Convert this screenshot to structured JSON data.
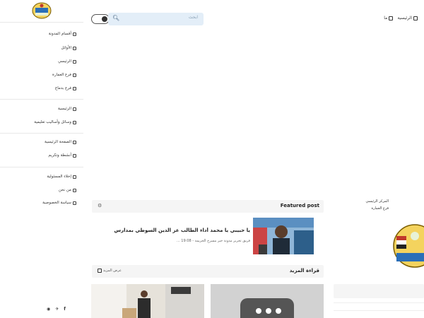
{
  "topbar": {
    "search_placeholder": "ابحث",
    "links": [
      {
        "label": "ما",
        "icon": "bookmark-icon"
      },
      {
        "label": "الرئيسية",
        "icon": "home-icon"
      }
    ]
  },
  "sidebar": {
    "logo": "school-logo",
    "groups": [
      [
        {
          "label": "أقسام المدونة",
          "icon": "grid-icon"
        },
        {
          "label": "الأوائل",
          "icon": "award-icon"
        },
        {
          "label": "الرئيسي",
          "icon": "home-icon"
        },
        {
          "label": "فرع العمارة",
          "icon": "building-icon"
        },
        {
          "label": "فرع بدماج",
          "icon": "building-icon"
        }
      ],
      [
        {
          "label": "الرئيسية",
          "icon": "home-icon"
        },
        {
          "label": "وسائل وأساليب تعليمية",
          "icon": "book-icon"
        }
      ],
      [
        {
          "label": "الصفحة الرئيسية",
          "icon": "page-icon"
        },
        {
          "label": "أنشطة وتكريم",
          "icon": "star-icon"
        }
      ],
      [
        {
          "label": "إخلاء المسئولية",
          "icon": "shield-icon"
        },
        {
          "label": "من نحن",
          "icon": "info-icon"
        },
        {
          "label": "سياسة الخصوصية",
          "icon": "lock-icon"
        }
      ]
    ],
    "social": [
      "facebook-icon",
      "twitter-icon",
      "share-icon"
    ]
  },
  "featured": {
    "heading": "Featured post",
    "title": "يا حبيبي يا محمد أداء الطالب عز الدين السوطي بمدارس",
    "meta": "فريق تحرير مدونة خير مسرح الجريمة - 19:08 ..."
  },
  "more": {
    "heading": "قراءة المزيد",
    "link": "عرض المزيد"
  },
  "right_sidebar": {
    "links": [
      "المركز الرئيسي",
      "فرع العمارة"
    ]
  }
}
